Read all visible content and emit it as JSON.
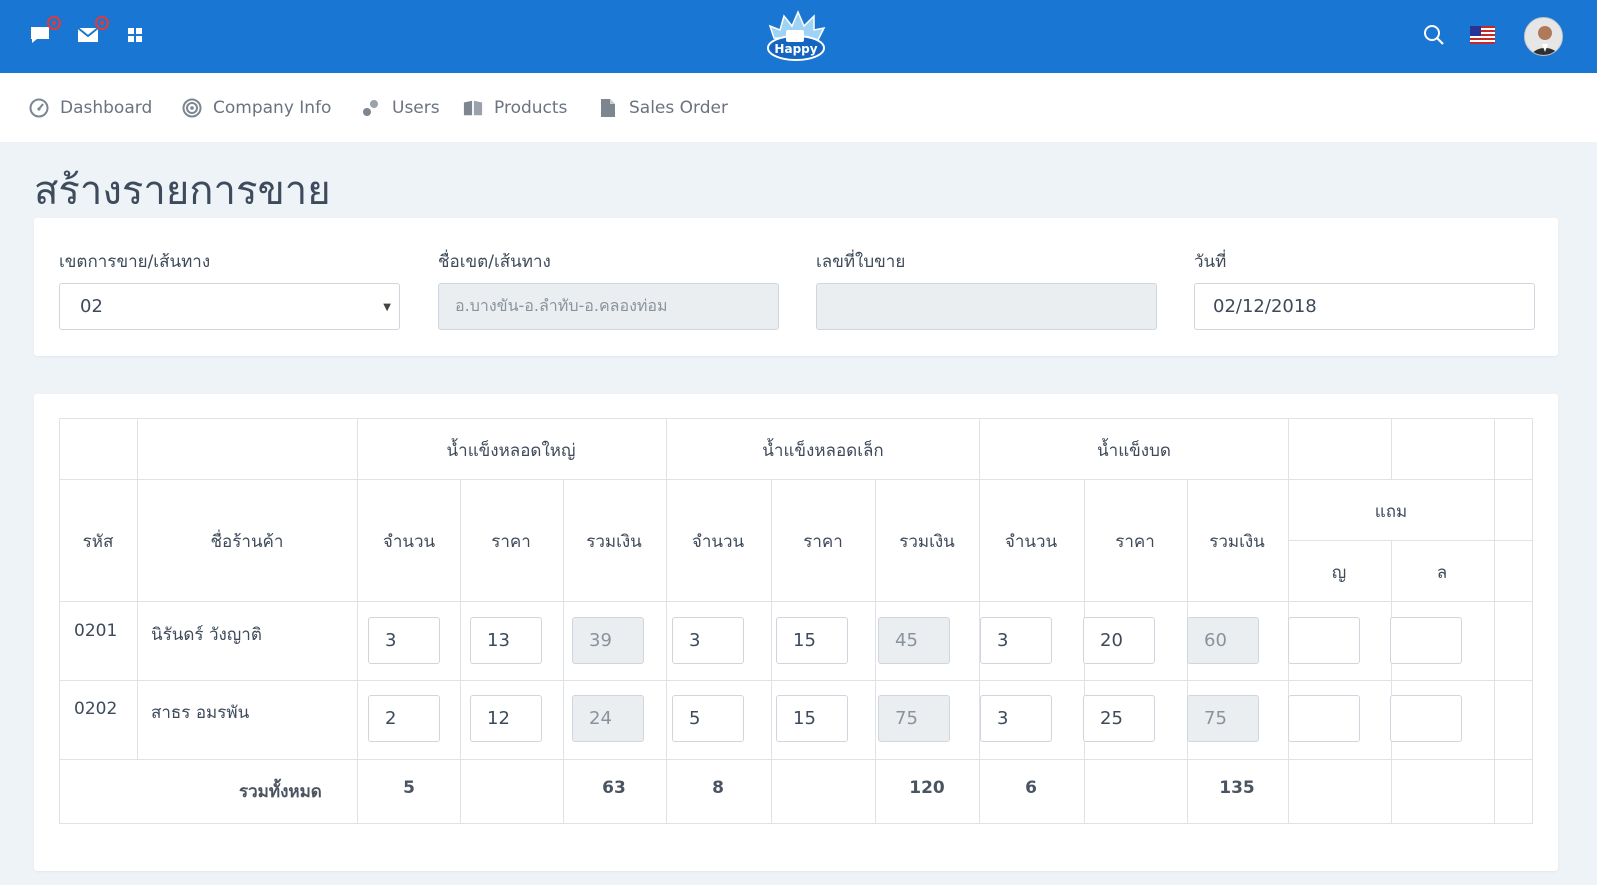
{
  "brand": {
    "logo_text": "Happy",
    "primary": "#1976d2"
  },
  "topbar": {
    "icons": [
      "chat-icon",
      "mail-icon",
      "apps-grid-icon",
      "search-icon",
      "us-flag-icon",
      "user-avatar"
    ]
  },
  "nav": {
    "items": [
      {
        "label": "Dashboard",
        "icon": "dashboard-icon"
      },
      {
        "label": "Company Info",
        "icon": "target-icon"
      },
      {
        "label": "Users",
        "icon": "users-icon"
      },
      {
        "label": "Products",
        "icon": "book-icon"
      },
      {
        "label": "Sales Order",
        "icon": "document-icon"
      }
    ]
  },
  "page": {
    "title": "สร้างรายการขาย"
  },
  "form": {
    "route_label": "เขตการขาย/เส้นทาง",
    "route_value": "02",
    "route_name_label": "ชื่อเขต/เส้นทาง",
    "route_name_value": "อ.บางขัน-อ.ลำทับ-อ.คลองท่อม",
    "invoice_label": "เลขที่ใบขาย",
    "invoice_value": "",
    "date_label": "วันที่",
    "date_value": "02/12/2018"
  },
  "table": {
    "groups": [
      "น้ำแข็งหลอดใหญ่",
      "น้ำแข็งหลอดเล็ก",
      "น้ำแข็งบด"
    ],
    "col_code": "รหัส",
    "col_shop": "ชื่อร้านค้า",
    "col_qty": "จำนวน",
    "col_price": "ราคา",
    "col_sum": "รวมเงิน",
    "col_free": "แถม",
    "col_free_a": "ญ",
    "col_free_b": "ล",
    "rows": [
      {
        "code": "0201",
        "shop": "นิรันดร์ วังญาติ",
        "big_qty": "3",
        "big_price": "13",
        "big_sum": "39",
        "small_qty": "3",
        "small_price": "15",
        "small_sum": "45",
        "crush_qty": "3",
        "crush_price": "20",
        "crush_sum": "60",
        "free_a": "",
        "free_b": ""
      },
      {
        "code": "0202",
        "shop": "สาธร อมรพัน",
        "big_qty": "2",
        "big_price": "12",
        "big_sum": "24",
        "small_qty": "5",
        "small_price": "15",
        "small_sum": "75",
        "crush_qty": "3",
        "crush_price": "25",
        "crush_sum": "75",
        "free_a": "",
        "free_b": ""
      }
    ],
    "total_label": "รวมทั้งหมด",
    "totals": {
      "big_qty": "5",
      "big_sum": "63",
      "small_qty": "8",
      "small_sum": "120",
      "crush_qty": "6",
      "crush_sum": "135"
    }
  }
}
